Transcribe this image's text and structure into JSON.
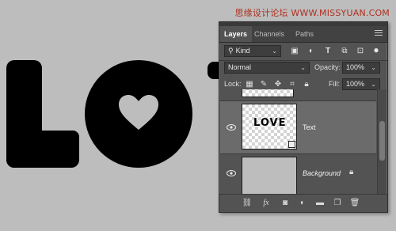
{
  "watermark": "思缘设计论坛 WWW.MISSYUAN.COM",
  "panel": {
    "tabs": [
      {
        "label": "Layers",
        "active": true
      },
      {
        "label": "Channels",
        "active": false
      },
      {
        "label": "Paths",
        "active": false
      }
    ],
    "filter": {
      "kind_label": "Kind"
    },
    "blend": {
      "mode": "Normal",
      "opacity_label": "Opacity:",
      "opacity_value": "100%"
    },
    "lock": {
      "label": "Lock:",
      "fill_label": "Fill:",
      "fill_value": "100%"
    },
    "layers": [
      {
        "name": "Text",
        "thumb_text": "LOVE",
        "selected": true,
        "visible": true
      },
      {
        "name": "Background",
        "selected": false,
        "visible": true,
        "locked": true
      }
    ]
  },
  "colors": {
    "canvas": "#bdbdbd",
    "panel": "#535353",
    "selected_layer": "#6b6b6b",
    "art": "#000000"
  }
}
